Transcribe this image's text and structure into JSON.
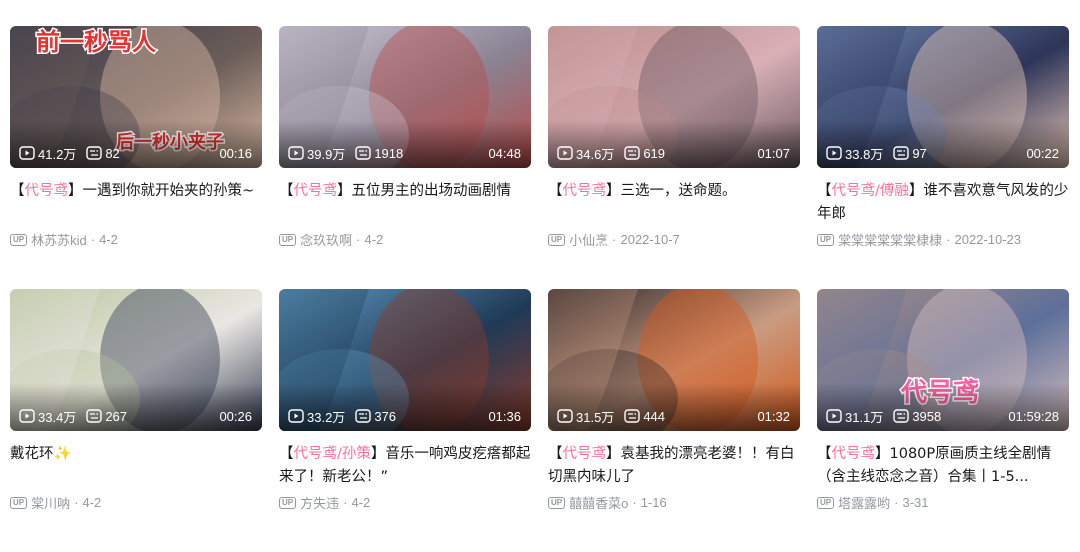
{
  "videos": [
    {
      "views": "41.2万",
      "danmaku": "82",
      "duration": "00:16",
      "tag": "",
      "title": "【代号鸢】一遇到你就开始夹的孙策~",
      "author": "林苏苏kid",
      "date": "4-2",
      "overlay_top": "前一秒骂人",
      "overlay_bottom": "后一秒小夹子",
      "colors": [
        "#3b3a4a",
        "#6b5d58",
        "#d9b9a3"
      ]
    },
    {
      "views": "39.9万",
      "danmaku": "1918",
      "duration": "04:48",
      "tag": "",
      "title": "【代号鸢】五位男主的出场动画剧情",
      "author": "念玖玖啊",
      "date": "4-2",
      "colors": [
        "#cfc9d6",
        "#8a8393",
        "#b84c49"
      ]
    },
    {
      "views": "34.6万",
      "danmaku": "619",
      "duration": "01:07",
      "tag": "",
      "title": "【代号鸢】三选一，送命题。",
      "author": "小仙烹",
      "date": "2022-10-7",
      "colors": [
        "#b98a8a",
        "#d9b0b6",
        "#6d5b62"
      ]
    },
    {
      "views": "33.8万",
      "danmaku": "97",
      "duration": "00:22",
      "tag": "",
      "title": "【代号鸢/傅融】谁不喜欢意气风发的少年郎",
      "author": "棠棠棠棠棠棠棣棣",
      "date": "2022-10-23",
      "colors": [
        "#6e86b3",
        "#2d3558",
        "#e7c8b7"
      ]
    },
    {
      "views": "33.4万",
      "danmaku": "267",
      "duration": "00:26",
      "tag": "",
      "title": "戴花环✨",
      "author": "棠川呐",
      "date": "4-2",
      "colors": [
        "#b6c69a",
        "#eae6e3",
        "#384155"
      ]
    },
    {
      "views": "33.2万",
      "danmaku": "376",
      "duration": "01:36",
      "tag": "",
      "title": "【代号鸢/孙策】音乐一响鸡皮疙瘩都起来了！新老公！”",
      "author": "方失违",
      "date": "4-2",
      "colors": [
        "#5f9ac0",
        "#1f3a57",
        "#8a3b2b"
      ]
    },
    {
      "views": "31.5万",
      "danmaku": "444",
      "duration": "01:32",
      "tag": "",
      "title": "【代号鸢】袁基我的漂亮老婆！！有白切黑内味儿了",
      "author": "囍囍香菜o",
      "date": "1-16",
      "colors": [
        "#2a2326",
        "#c99c82",
        "#d5591c"
      ]
    },
    {
      "views": "31.1万",
      "danmaku": "3958",
      "duration": "01:59:28",
      "tag": "",
      "title": "【代号鸢】1080P原画质主线全剧情（含主线恋念之音）合集丨1-5...",
      "author": "塔露露哟",
      "date": "3-31",
      "overlay_bottom": "代号鸢",
      "colors": [
        "#ab8f85",
        "#5d6f9a",
        "#d6bfbf"
      ]
    }
  ]
}
